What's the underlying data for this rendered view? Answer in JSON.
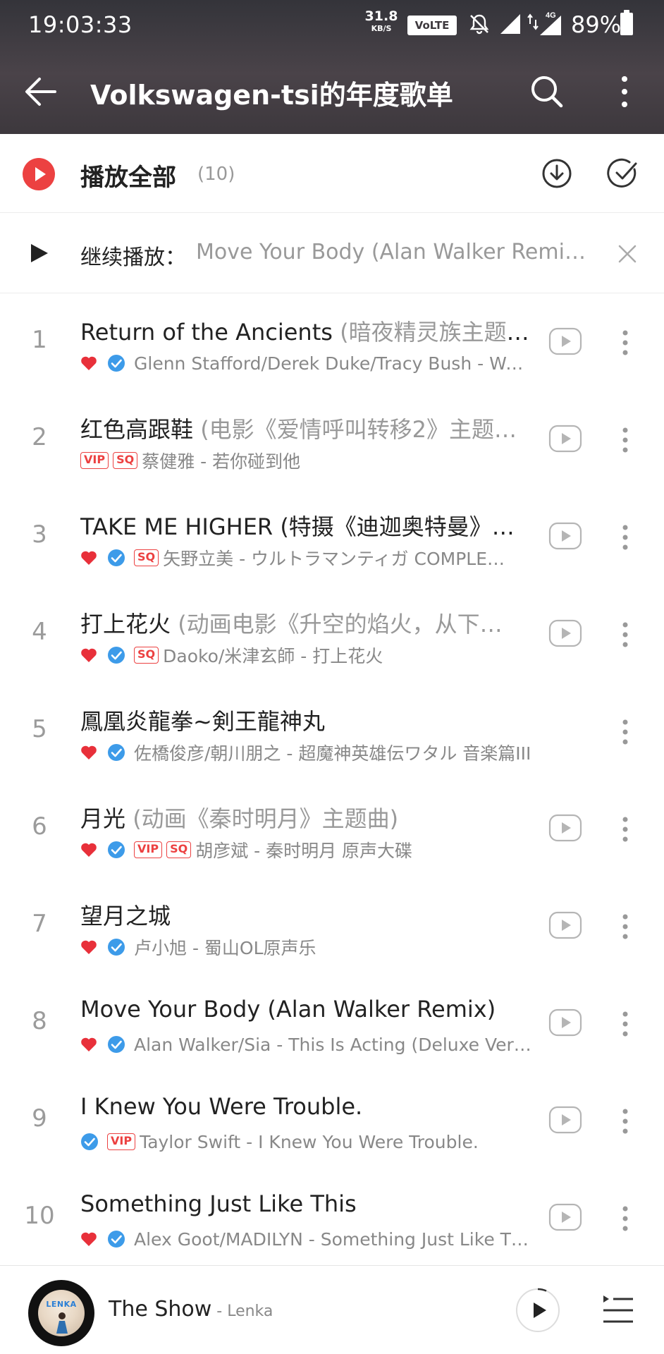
{
  "status_bar": {
    "time": "19:03:33",
    "net_speed_value": "31.8",
    "net_speed_unit": "KB/S",
    "volte": "VoLTE",
    "network": "4G",
    "battery": "89%"
  },
  "header": {
    "title": "Volkswagen-tsi的年度歌单"
  },
  "play_all": {
    "label": "播放全部",
    "count": "(10)"
  },
  "continue_play": {
    "label": "继续播放：",
    "song": "Move Your Body (Alan Walker Remix)…"
  },
  "songs": [
    {
      "num": "1",
      "title": "Return of the Ancients",
      "subtitle": " (暗夜精灵族主题曲)",
      "liked": true,
      "verified": true,
      "badges": [],
      "artist": "Glenn Stafford/Derek Duke/Tracy Bush - Wa…",
      "mv": true
    },
    {
      "num": "2",
      "title": "红色高跟鞋",
      "subtitle": " (电影《爱情呼叫转移2》主题…",
      "liked": false,
      "verified": false,
      "badges": [
        "VIP",
        "SQ"
      ],
      "artist": "蔡健雅 - 若你碰到他",
      "mv": true
    },
    {
      "num": "3",
      "title": "TAKE ME HIGHER (特摄《迪迦奥特曼》…",
      "subtitle": "",
      "liked": true,
      "verified": true,
      "badges": [
        "SQ"
      ],
      "artist": "矢野立美 - ウルトラマンティガ COMPLE…",
      "mv": true
    },
    {
      "num": "4",
      "title": "打上花火",
      "subtitle": " (动画电影《升空的焰火，从下…",
      "liked": true,
      "verified": true,
      "badges": [
        "SQ"
      ],
      "artist": "Daoko/米津玄師 - 打上花火",
      "mv": true
    },
    {
      "num": "5",
      "title": "鳳凰炎龍拳~剣王龍神丸",
      "subtitle": "",
      "liked": true,
      "verified": true,
      "badges": [],
      "artist": "佐橋俊彦/朝川朋之 - 超魔神英雄伝ワタル 音楽篇III",
      "mv": false
    },
    {
      "num": "6",
      "title": "月光",
      "subtitle": " (动画《秦时明月》主题曲)",
      "liked": true,
      "verified": true,
      "badges": [
        "VIP",
        "SQ"
      ],
      "artist": "胡彦斌 - 秦时明月 原声大碟",
      "mv": true
    },
    {
      "num": "7",
      "title": "望月之城",
      "subtitle": "",
      "liked": true,
      "verified": true,
      "badges": [],
      "artist": "卢小旭 - 蜀山OL原声乐",
      "mv": true
    },
    {
      "num": "8",
      "title": "Move Your Body (Alan Walker Remix)",
      "subtitle": "",
      "liked": true,
      "verified": true,
      "badges": [],
      "artist": "Alan Walker/Sia - This Is Acting (Deluxe Ver…",
      "mv": true
    },
    {
      "num": "9",
      "title": "I Knew You Were Trouble.",
      "subtitle": "",
      "liked": false,
      "verified": true,
      "badges": [
        "VIP"
      ],
      "artist": "Taylor Swift - I Knew You Were Trouble.",
      "mv": true
    },
    {
      "num": "10",
      "title": "Something Just Like This",
      "subtitle": "",
      "liked": true,
      "verified": true,
      "badges": [],
      "artist": "Alex Goot/MADILYN - Something Just Like T…",
      "mv": true
    }
  ],
  "now_playing": {
    "title": "The Show",
    "artist": " - Lenka",
    "album_text": "LENKA"
  },
  "icons": {
    "back": "back-arrow-icon",
    "search": "search-icon",
    "more": "more-vertical-icon",
    "play_all": "play-circle-icon",
    "download": "download-icon",
    "multi_select": "check-circle-icon",
    "close": "close-icon",
    "heart": "heart-icon",
    "verified": "verified-check-icon",
    "mv": "video-play-icon",
    "playlist": "playlist-icon"
  },
  "colors": {
    "accent": "#ec4141",
    "verified": "#3d9be9",
    "header_bg": "#3d383d",
    "muted_text": "#999999"
  }
}
